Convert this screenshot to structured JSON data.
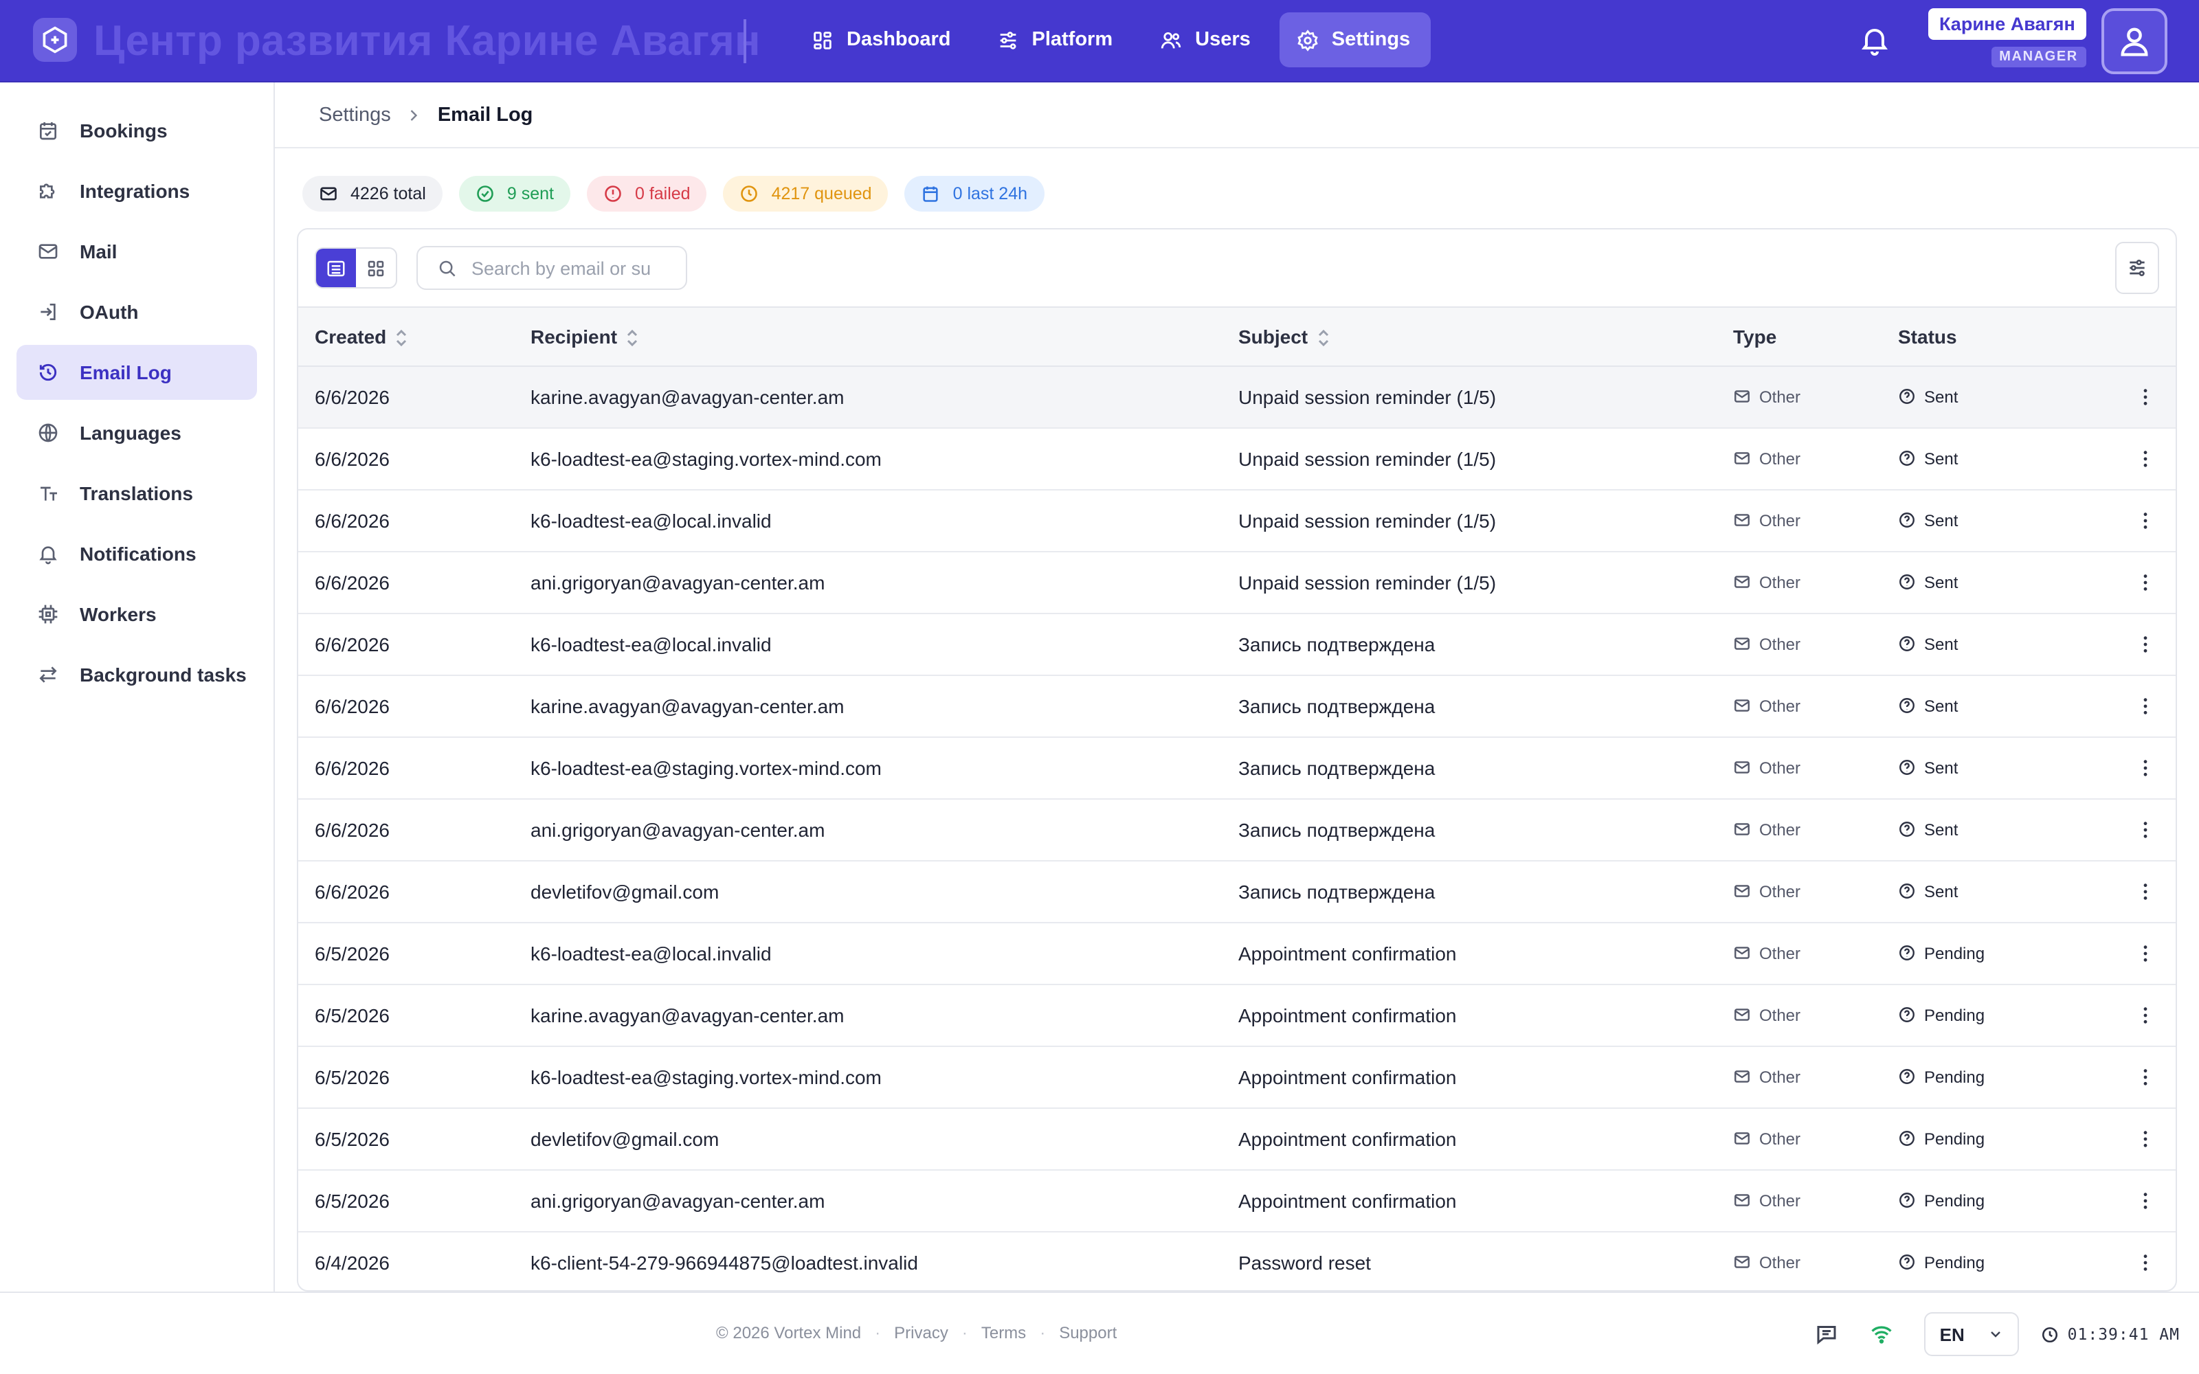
{
  "header": {
    "brand": "Центр развития Карине Авагян",
    "nav": [
      {
        "label": "Dashboard",
        "icon": "dashboard-icon"
      },
      {
        "label": "Platform",
        "icon": "sliders-icon"
      },
      {
        "label": "Users",
        "icon": "users-icon"
      },
      {
        "label": "Settings",
        "icon": "gear-icon",
        "active": true
      }
    ],
    "user_name": "Карине Авагян",
    "user_role": "MANAGER",
    "accent": "#4538cf"
  },
  "sidebar": {
    "items": [
      {
        "label": "Bookings",
        "icon": "calendar-check-icon"
      },
      {
        "label": "Integrations",
        "icon": "puzzle-icon"
      },
      {
        "label": "Mail",
        "icon": "mail-icon"
      },
      {
        "label": "OAuth",
        "icon": "login-icon"
      },
      {
        "label": "Email Log",
        "icon": "history-icon",
        "active": true
      },
      {
        "label": "Languages",
        "icon": "globe-icon"
      },
      {
        "label": "Translations",
        "icon": "text-size-icon"
      },
      {
        "label": "Notifications",
        "icon": "bell-icon"
      },
      {
        "label": "Workers",
        "icon": "cpu-icon"
      },
      {
        "label": "Background tasks",
        "icon": "arrows-exchange-icon"
      }
    ]
  },
  "breadcrumb": {
    "parent": "Settings",
    "current": "Email Log"
  },
  "stats": {
    "total": "4226 total",
    "sent": "9 sent",
    "failed": "0 failed",
    "queued": "4217 queued",
    "last24": "0 last 24h"
  },
  "search": {
    "placeholder": "Search by email or su",
    "value": ""
  },
  "table": {
    "columns": {
      "created": "Created",
      "recipient": "Recipient",
      "subject": "Subject",
      "type": "Type",
      "status": "Status"
    },
    "rows": [
      {
        "created": "6/6/2026",
        "recipient": "karine.avagyan@avagyan-center.am",
        "subject": "Unpaid session reminder (1/5)",
        "type": "Other",
        "status": "Sent"
      },
      {
        "created": "6/6/2026",
        "recipient": "k6-loadtest-ea@staging.vortex-mind.com",
        "subject": "Unpaid session reminder (1/5)",
        "type": "Other",
        "status": "Sent"
      },
      {
        "created": "6/6/2026",
        "recipient": "k6-loadtest-ea@local.invalid",
        "subject": "Unpaid session reminder (1/5)",
        "type": "Other",
        "status": "Sent"
      },
      {
        "created": "6/6/2026",
        "recipient": "ani.grigoryan@avagyan-center.am",
        "subject": "Unpaid session reminder (1/5)",
        "type": "Other",
        "status": "Sent"
      },
      {
        "created": "6/6/2026",
        "recipient": "k6-loadtest-ea@local.invalid",
        "subject": "Запись подтверждена",
        "type": "Other",
        "status": "Sent"
      },
      {
        "created": "6/6/2026",
        "recipient": "karine.avagyan@avagyan-center.am",
        "subject": "Запись подтверждена",
        "type": "Other",
        "status": "Sent"
      },
      {
        "created": "6/6/2026",
        "recipient": "k6-loadtest-ea@staging.vortex-mind.com",
        "subject": "Запись подтверждена",
        "type": "Other",
        "status": "Sent"
      },
      {
        "created": "6/6/2026",
        "recipient": "ani.grigoryan@avagyan-center.am",
        "subject": "Запись подтверждена",
        "type": "Other",
        "status": "Sent"
      },
      {
        "created": "6/6/2026",
        "recipient": "devletifov@gmail.com",
        "subject": "Запись подтверждена",
        "type": "Other",
        "status": "Sent"
      },
      {
        "created": "6/5/2026",
        "recipient": "k6-loadtest-ea@local.invalid",
        "subject": "Appointment confirmation",
        "type": "Other",
        "status": "Pending"
      },
      {
        "created": "6/5/2026",
        "recipient": "karine.avagyan@avagyan-center.am",
        "subject": "Appointment confirmation",
        "type": "Other",
        "status": "Pending"
      },
      {
        "created": "6/5/2026",
        "recipient": "k6-loadtest-ea@staging.vortex-mind.com",
        "subject": "Appointment confirmation",
        "type": "Other",
        "status": "Pending"
      },
      {
        "created": "6/5/2026",
        "recipient": "devletifov@gmail.com",
        "subject": "Appointment confirmation",
        "type": "Other",
        "status": "Pending"
      },
      {
        "created": "6/5/2026",
        "recipient": "ani.grigoryan@avagyan-center.am",
        "subject": "Appointment confirmation",
        "type": "Other",
        "status": "Pending"
      },
      {
        "created": "6/4/2026",
        "recipient": "k6-client-54-279-966944875@loadtest.invalid",
        "subject": "Password reset",
        "type": "Other",
        "status": "Pending"
      }
    ]
  },
  "footer": {
    "copyright": "© 2026 Vortex Mind",
    "links": [
      "Privacy",
      "Terms",
      "Support"
    ],
    "language": "EN",
    "time": "01:39:41 AM"
  }
}
